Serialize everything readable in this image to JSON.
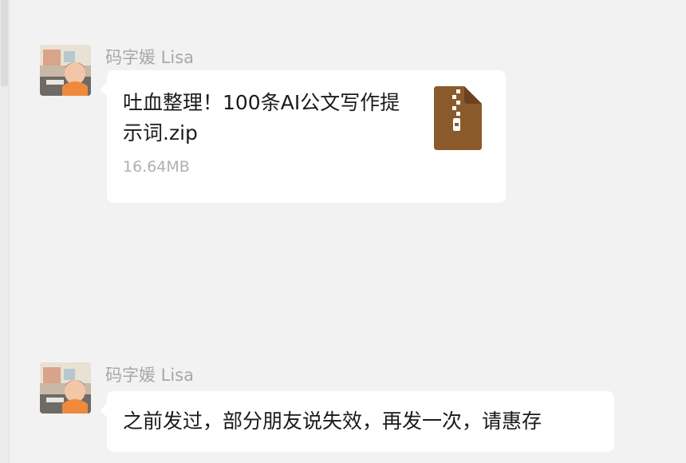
{
  "messages": [
    {
      "sender": "码字媛 Lisa",
      "file": {
        "name": "吐血整理！100条AI公文写作提示词.zip",
        "size": "16.64MB",
        "icon": "zip-file-icon",
        "icon_color": "#8b5a2b"
      }
    },
    {
      "sender": "码字媛 Lisa",
      "text": "之前发过，部分朋友说失效，再发一次，请惠存"
    }
  ]
}
